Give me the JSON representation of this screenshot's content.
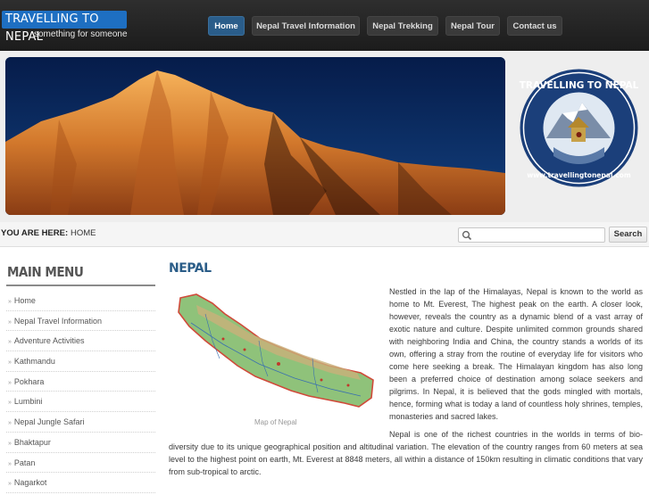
{
  "header": {
    "logo_text": "TRAVELLING TO NEPAL",
    "tagline": "something for someone",
    "nav": [
      {
        "label": "Home",
        "active": true
      },
      {
        "label": "Nepal Travel Information",
        "active": false
      },
      {
        "label": "Nepal Trekking",
        "active": false
      },
      {
        "label": "Nepal Tour",
        "active": false
      },
      {
        "label": "Contact us",
        "active": false
      }
    ]
  },
  "banner": {
    "badge_text_top": "TRAVELLING TO NEPAL",
    "badge_text_bottom": "www.travellingtonepal.com"
  },
  "breadcrumb": {
    "label": "YOU ARE HERE:",
    "current": "HOME"
  },
  "search": {
    "placeholder": "",
    "button_label": "Search"
  },
  "sidebar": {
    "title": "MAIN MENU",
    "items": [
      "Home",
      "Nepal Travel Information",
      "Adventure Activities",
      "Kathmandu",
      "Pokhara",
      "Lumbini",
      "Nepal Jungle Safari",
      "Bhaktapur",
      "Patan",
      "Nagarkot"
    ]
  },
  "content": {
    "title": "NEPAL",
    "map_caption": "Map of Nepal",
    "paragraph1": "Nestled in the lap of the Himalayas, Nepal is known to the world as home to Mt. Everest, The highest peak on the earth. A closer look, however, reveals the country as a dynamic blend of a vast array of exotic nature and culture. Despite unlimited common grounds shared with neighboring India and China, the country stands a worlds of its own, offering a stray from the routine of everyday life for visitors who come here seeking a break. The Himalayan kingdom has also long been a preferred choice of destination among solace seekers and pilgrims. In Nepal, it is believed that the gods mingled with mortals, hence, forming what is today a land of countless holy shrines, temples, monasteries and sacred lakes.",
    "paragraph2": "Nepal is one of the richest countries in the worlds in terms of bio-diversity due to its unique geographical position and altitudinal variation. The elevation of the country ranges from 60 meters at sea level to the highest point on earth, Mt. Everest at 8848 meters, all within a distance of 150km resulting in climatic conditions that vary from sub-tropical to arctic."
  },
  "colors": {
    "header_bg": "#1c1c1c",
    "logo_blue": "#1e6fc2",
    "nav_active": "#2a5d8a",
    "title_blue": "#2b5d88"
  }
}
